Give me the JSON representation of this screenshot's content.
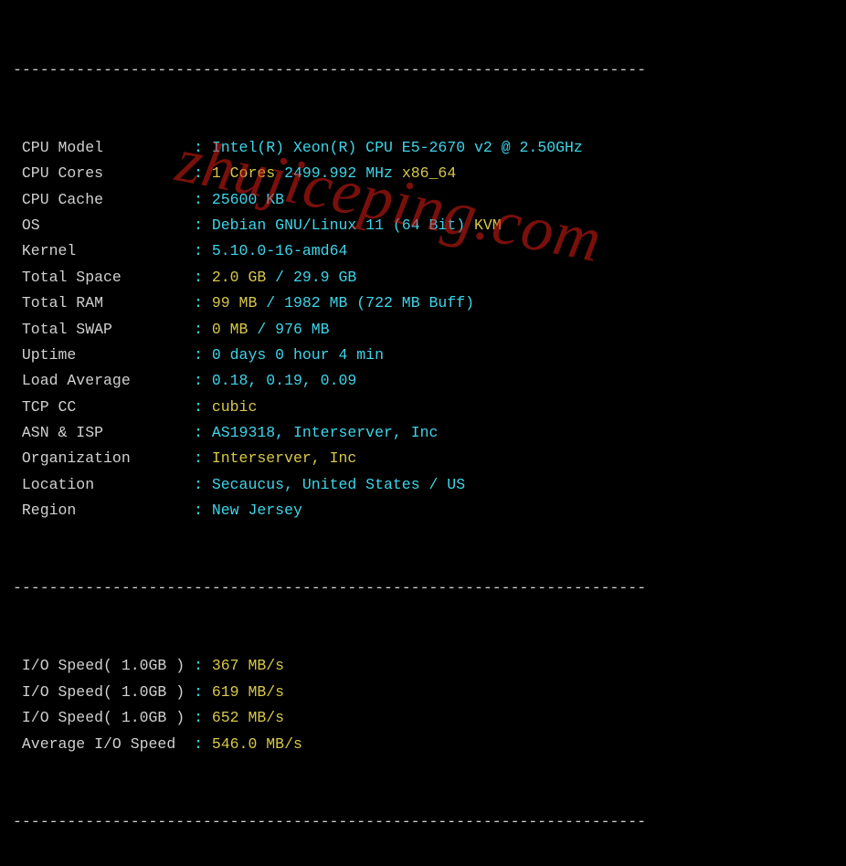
{
  "divider": "----------------------------------------------------------------------",
  "watermark": "zhujiceping.com",
  "rows": [
    {
      "label": "CPU Model          ",
      "colon": ":",
      "parts": [
        {
          "cls": "cyan",
          "t": " Intel(R) Xeon(R) CPU E5-2670 v2 @ 2.50GHz"
        }
      ]
    },
    {
      "label": "CPU Cores          ",
      "colon": ":",
      "parts": [
        {
          "cls": "yel",
          "t": " 1 Cores "
        },
        {
          "cls": "cyan",
          "t": "2499.992 MHz "
        },
        {
          "cls": "yel",
          "t": "x86_64"
        }
      ]
    },
    {
      "label": "CPU Cache          ",
      "colon": ":",
      "parts": [
        {
          "cls": "cyan",
          "t": " 25600 KB"
        }
      ]
    },
    {
      "label": "OS                 ",
      "colon": ":",
      "parts": [
        {
          "cls": "cyan",
          "t": " Debian GNU/Linux 11 (64 Bit) "
        },
        {
          "cls": "yel",
          "t": "KVM"
        }
      ]
    },
    {
      "label": "Kernel             ",
      "colon": ":",
      "parts": [
        {
          "cls": "cyan",
          "t": " 5.10.0-16-amd64"
        }
      ]
    },
    {
      "label": "Total Space        ",
      "colon": ":",
      "parts": [
        {
          "cls": "yel",
          "t": " 2.0 GB "
        },
        {
          "cls": "cyan",
          "t": "/ 29.9 GB"
        }
      ]
    },
    {
      "label": "Total RAM          ",
      "colon": ":",
      "parts": [
        {
          "cls": "yel",
          "t": " 99 MB "
        },
        {
          "cls": "cyan",
          "t": "/ 1982 MB (722 MB Buff)"
        }
      ]
    },
    {
      "label": "Total SWAP         ",
      "colon": ":",
      "parts": [
        {
          "cls": "yel",
          "t": " 0 MB "
        },
        {
          "cls": "cyan",
          "t": "/ 976 MB"
        }
      ]
    },
    {
      "label": "Uptime             ",
      "colon": ":",
      "parts": [
        {
          "cls": "cyan",
          "t": " 0 days 0 hour 4 min"
        }
      ]
    },
    {
      "label": "Load Average       ",
      "colon": ":",
      "parts": [
        {
          "cls": "cyan",
          "t": " 0.18, 0.19, 0.09"
        }
      ]
    },
    {
      "label": "TCP CC             ",
      "colon": ":",
      "parts": [
        {
          "cls": "yel",
          "t": " cubic"
        }
      ]
    },
    {
      "label": "ASN & ISP          ",
      "colon": ":",
      "parts": [
        {
          "cls": "cyan",
          "t": " AS19318, Interserver, Inc"
        }
      ]
    },
    {
      "label": "Organization       ",
      "colon": ":",
      "parts": [
        {
          "cls": "yel",
          "t": " Interserver, Inc"
        }
      ]
    },
    {
      "label": "Location           ",
      "colon": ":",
      "parts": [
        {
          "cls": "cyan",
          "t": " Secaucus, United States / US"
        }
      ]
    },
    {
      "label": "Region             ",
      "colon": ":",
      "parts": [
        {
          "cls": "cyan",
          "t": " New Jersey"
        }
      ]
    }
  ],
  "io_rows": [
    {
      "label": "I/O Speed( 1.0GB ) ",
      "colon": ":",
      "parts": [
        {
          "cls": "yel",
          "t": " 367 MB/s"
        }
      ]
    },
    {
      "label": "I/O Speed( 1.0GB ) ",
      "colon": ":",
      "parts": [
        {
          "cls": "yel",
          "t": " 619 MB/s"
        }
      ]
    },
    {
      "label": "I/O Speed( 1.0GB ) ",
      "colon": ":",
      "parts": [
        {
          "cls": "yel",
          "t": " 652 MB/s"
        }
      ]
    },
    {
      "label": "Average I/O Speed  ",
      "colon": ":",
      "parts": [
        {
          "cls": "yel",
          "t": " 546.0 MB/s"
        }
      ]
    }
  ]
}
